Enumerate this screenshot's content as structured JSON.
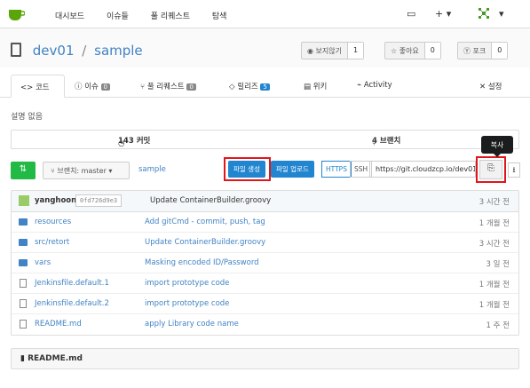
{
  "topnav": {
    "items": [
      "대시보드",
      "이슈들",
      "풀 리퀘스트",
      "탐색"
    ],
    "plus": "+ ▾"
  },
  "repo": {
    "owner": "dev01",
    "sep": "/",
    "name": "sample"
  },
  "stats": [
    {
      "label": "◉ 보지않기",
      "count": "1"
    },
    {
      "label": "☆ 좋아요",
      "count": "0"
    },
    {
      "label": "Ⓨ 포크",
      "count": "0"
    }
  ],
  "tabs": [
    {
      "label": "<> 코드",
      "badge": ""
    },
    {
      "label": "ⓘ 이슈",
      "badge": "0"
    },
    {
      "label": "풀 리퀘스트",
      "badge": "0"
    },
    {
      "label": "릴리즈",
      "badge": "5"
    },
    {
      "label": "위키",
      "badge": ""
    },
    {
      "label": "Activity",
      "badge": ""
    },
    {
      "label": "설정",
      "badge": ""
    }
  ],
  "description": "설명 없음",
  "summary": {
    "commits": "143 커밋",
    "branches": "4 브랜치"
  },
  "branch": {
    "label": "브랜치: master ▾",
    "path": "sample"
  },
  "actions": {
    "new_file": "파일 생성",
    "upload": "파일 업로드",
    "https": "HTTPS",
    "ssh": "SSH",
    "url": "https://git.cloudzcp.io/dev01",
    "tooltip": "복사"
  },
  "commit": {
    "author": "yanghoon",
    "sha": "0fd726d9e3",
    "message": "Update ContainerBuilder.groovy",
    "age": "3 시간 전"
  },
  "files": [
    {
      "name": "resources",
      "type": "folder",
      "message": "Add gitCmd - commit, push, tag",
      "age": "1 개월 전"
    },
    {
      "name": "src/retort",
      "type": "folder",
      "message": "Update ContainerBuilder.groovy",
      "age": "3 시간 전"
    },
    {
      "name": "vars",
      "type": "folder",
      "message": "Masking encoded ID/Password",
      "age": "3 일 전"
    },
    {
      "name": "Jenkinsfile.default.1",
      "type": "file",
      "message": "import prototype code",
      "age": "1 개월 전"
    },
    {
      "name": "Jenkinsfile.default.2",
      "type": "file",
      "message": "import prototype code",
      "age": "1 개월 전"
    },
    {
      "name": "README.md",
      "type": "file",
      "message": "apply Library code name",
      "age": "1 주 전"
    }
  ],
  "readme": {
    "title": "README.md"
  },
  "colors": {
    "accent": "#2185d0",
    "highlight": "#e0161b",
    "green": "#21ba45"
  }
}
